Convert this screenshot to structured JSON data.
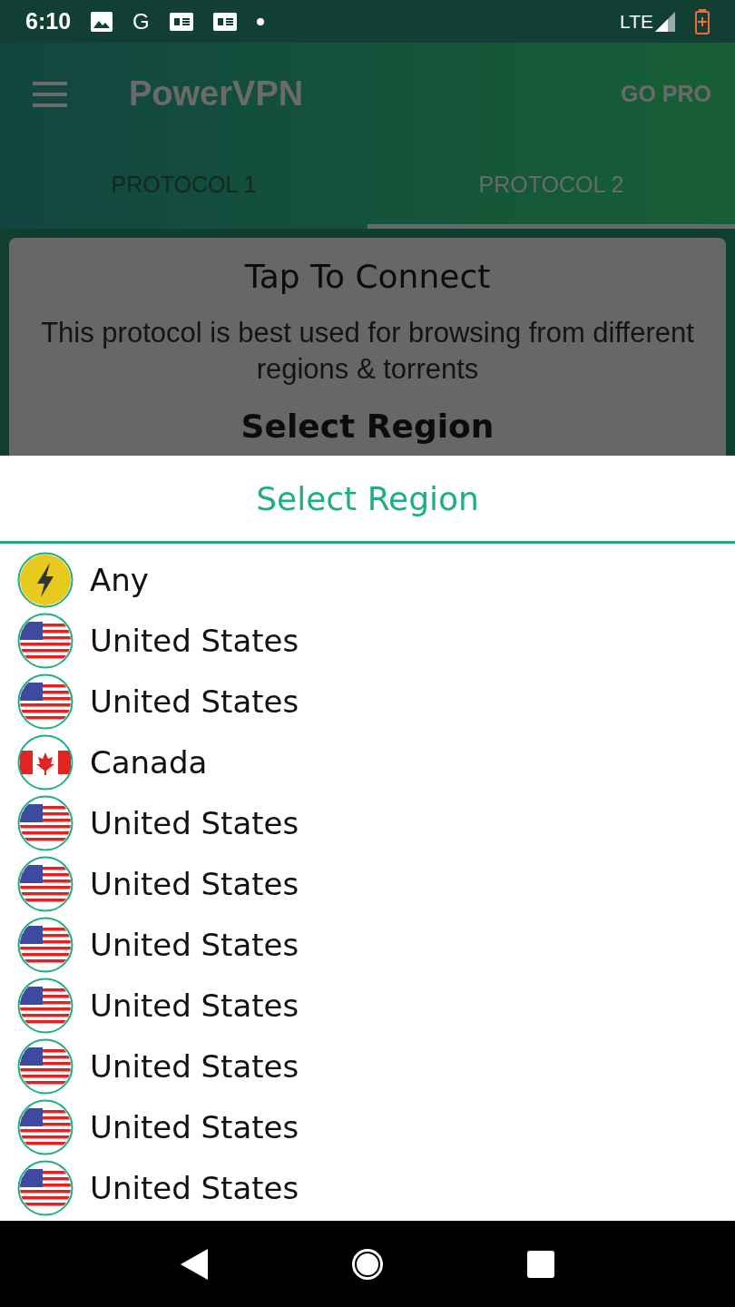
{
  "status_bar": {
    "time": "6:10",
    "letter": "G",
    "network": "LTE"
  },
  "app_bar": {
    "title": "PowerVPN",
    "action": "GO PRO"
  },
  "tabs": [
    {
      "label": "PROTOCOL 1",
      "selected": false
    },
    {
      "label": "PROTOCOL 2",
      "selected": true
    }
  ],
  "card": {
    "title": "Tap To Connect",
    "description": "This protocol is best used for browsing from different regions & torrents",
    "section": "Select Region"
  },
  "sheet": {
    "title": "Select Region",
    "regions": [
      {
        "kind": "any",
        "name": "Any"
      },
      {
        "kind": "us",
        "name": "United States"
      },
      {
        "kind": "us",
        "name": "United States"
      },
      {
        "kind": "ca",
        "name": "Canada"
      },
      {
        "kind": "us",
        "name": "United States"
      },
      {
        "kind": "us",
        "name": "United States"
      },
      {
        "kind": "us",
        "name": "United States"
      },
      {
        "kind": "us",
        "name": "United States"
      },
      {
        "kind": "us",
        "name": "United States"
      },
      {
        "kind": "us",
        "name": "United States"
      },
      {
        "kind": "us",
        "name": "United States"
      }
    ]
  }
}
